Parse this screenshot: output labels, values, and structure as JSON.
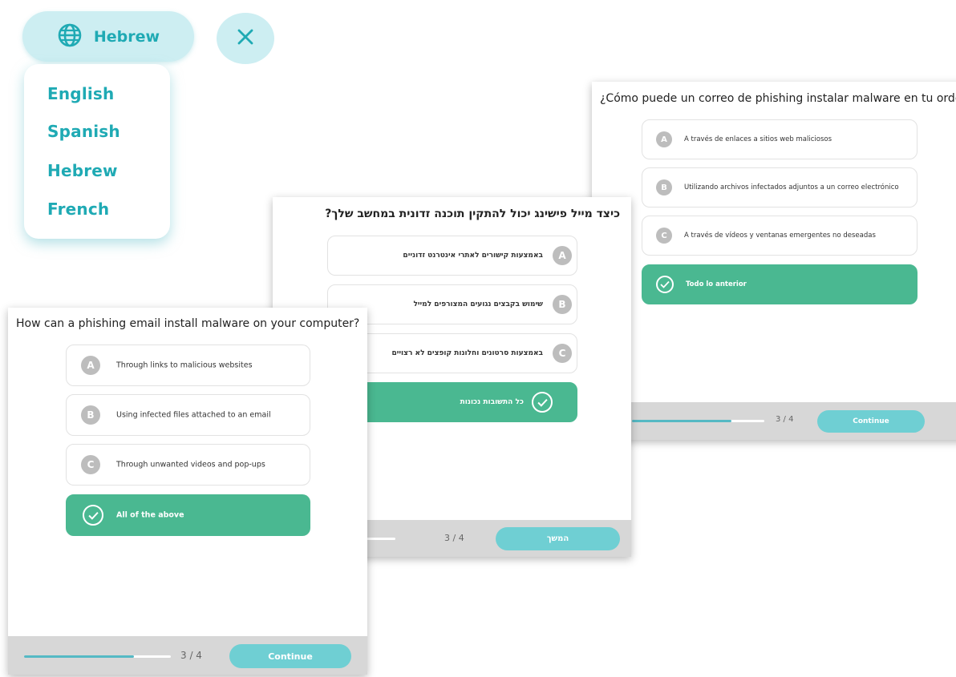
{
  "language_picker": {
    "current_language": "Hebrew",
    "globe_icon": "globe-icon",
    "close_icon": "close-icon",
    "options": [
      "English",
      "Spanish",
      "Hebrew",
      "French"
    ],
    "accent_color": "#1faab4",
    "bg_color": "#cdeef2"
  },
  "card_spanish": {
    "question": "¿Cómo puede un correo de phishing instalar malware en tu ordenador?",
    "options": [
      {
        "letter": "A",
        "text": "A través de enlaces a sitios web maliciosos"
      },
      {
        "letter": "B",
        "text": "Utilizando archivos infectados adjuntos a un correo electrónico"
      },
      {
        "letter": "C",
        "text": "A través de vídeos y ventanas emergentes no deseadas"
      },
      {
        "letter": "",
        "text": "Todo lo anterior",
        "selected": true
      }
    ],
    "progress_text": "3 / 4",
    "progress_fraction": 0.75,
    "continue_label": "Continue"
  },
  "card_hebrew": {
    "question": "כיצד מייל פישינג יכול להתקין תוכנה זדונית במחשב שלך?",
    "options": [
      {
        "letter": "A",
        "text": "באמצעות קישורים לאתרי אינטרנט זדוניים"
      },
      {
        "letter": "B",
        "text": "שימוש בקבצים נגועים המצורפים למייל"
      },
      {
        "letter": "C",
        "text": "באמצעות סרטונים וחלונות קופצים לא רצויים"
      },
      {
        "letter": "",
        "text": "כל התשובות נכונות",
        "selected": true
      }
    ],
    "progress_text": "3 / 4",
    "progress_fraction": 0.75,
    "continue_label": "המשך"
  },
  "card_english": {
    "question": "How can a phishing email install malware on your computer?",
    "options": [
      {
        "letter": "A",
        "text": "Through links to malicious websites"
      },
      {
        "letter": "B",
        "text": "Using infected files attached to an email"
      },
      {
        "letter": "C",
        "text": "Through unwanted videos and pop-ups"
      },
      {
        "letter": "",
        "text": "All of the above",
        "selected": true
      }
    ],
    "progress_text": "3 / 4",
    "progress_fraction": 0.75,
    "continue_label": "Continue"
  },
  "colors": {
    "selected_option": "#4ab891",
    "continue_button": "#6fcfd3",
    "progress_fill": "#55b9c4",
    "footer_bg": "#d7d7d7"
  },
  "check_icon": "check-icon"
}
